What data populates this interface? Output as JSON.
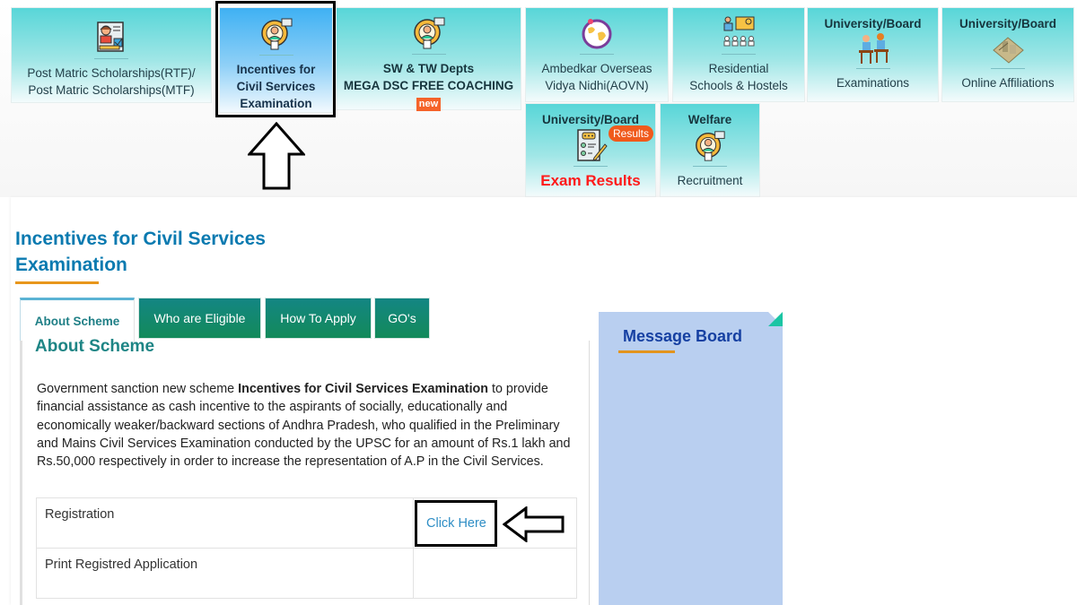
{
  "service_cards": [
    {
      "label_line1": "Post Matric Scholarships(RTF)/",
      "label_line2": "Post Matric Scholarships(MTF)",
      "icon": "scholarship-icon"
    },
    {
      "label_line1": "Incentives for",
      "label_line2": "Civil Services",
      "label_line3": "Examination",
      "icon": "civil-services-gear-icon",
      "active": true
    },
    {
      "label_line1": "SW & TW Depts",
      "label_line2": "MEGA DSC FREE COACHING",
      "badge": "new",
      "icon": "coaching-gear-icon"
    },
    {
      "label_line1": "Ambedkar Overseas",
      "label_line2": "Vidya Nidhi(AOVN)",
      "icon": "globe-icon"
    },
    {
      "label_line1": "Residential",
      "label_line2": "Schools & Hostels",
      "icon": "classroom-icon"
    },
    {
      "header": "University/Board",
      "label_line1": "Examinations",
      "icon": "exam-desk-icon"
    },
    {
      "header": "University/Board",
      "label_line1": "Online Affiliations",
      "icon": "campus-building-icon"
    },
    {
      "header": "University/Board",
      "badge": "Results",
      "label_line1": "Exam Results",
      "icon": "exam-sheet-icon"
    },
    {
      "header": "Welfare",
      "label_line1": "Recruitment",
      "icon": "recruitment-gear-icon"
    }
  ],
  "page": {
    "title": "Incentives for Civil Services Examination"
  },
  "tabs": [
    {
      "label": "About Scheme",
      "active": true
    },
    {
      "label": "Who are Eligible"
    },
    {
      "label": "How To Apply"
    },
    {
      "label": "GO's"
    }
  ],
  "about": {
    "heading": "About Scheme",
    "text_prefix": "Government sanction new scheme ",
    "text_bold": "Incentives for Civil Services Examination",
    "text_suffix": " to provide financial assistance as cash incentive to the aspirants of socially, educationally and economically weaker/backward sections of Andhra Pradesh, who qualified in the Preliminary and Mains Civil Services Examination conducted by the UPSC for an amount of Rs.1 lakh and Rs.50,000 respectively in order to increase the representation of A.P in the Civil Services."
  },
  "actions_table": [
    {
      "label": "Registration",
      "link": "Click Here"
    },
    {
      "label": "Print Registred Application",
      "link": ""
    }
  ],
  "message_board": {
    "title": "Message Board"
  },
  "colors": {
    "card_gradient_top": "#58d6d8",
    "active_card_top": "#3fb1f3",
    "title_blue": "#0a7ab0",
    "tab_green": "#138683",
    "accent_orange": "#e8961b",
    "message_board_bg": "#b9cff0",
    "results_badge": "#f05a1c",
    "exam_results_red": "#ff1a1a"
  }
}
